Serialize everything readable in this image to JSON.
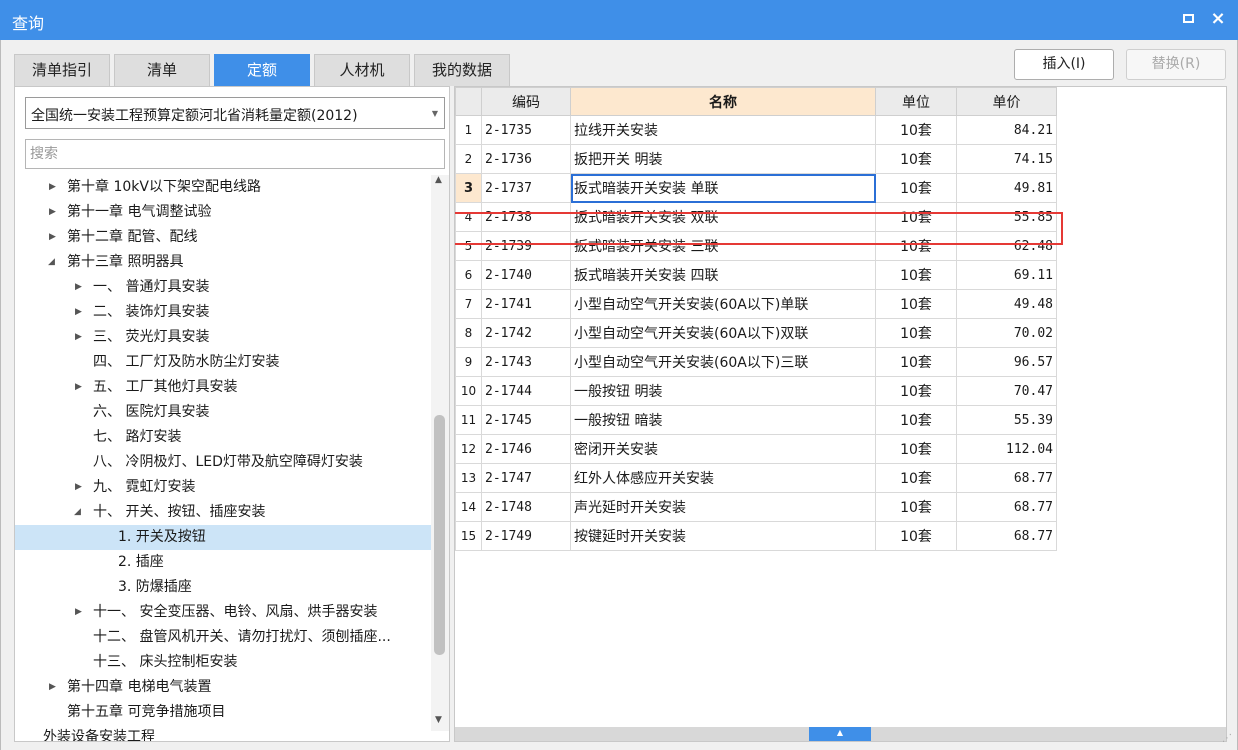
{
  "window": {
    "title": "查询",
    "restore_icon": "restore-icon",
    "close_glyph": "×"
  },
  "tabs": [
    {
      "label": "清单指引",
      "active": false
    },
    {
      "label": "清单",
      "active": false
    },
    {
      "label": "定额",
      "active": true
    },
    {
      "label": "人材机",
      "active": false
    },
    {
      "label": "我的数据",
      "active": false
    }
  ],
  "buttons": {
    "insert": "插入(I)",
    "replace": "替换(R)"
  },
  "left": {
    "combo_value": "全国统一安装工程预算定额河北省消耗量定额(2012)",
    "search_placeholder": "搜索",
    "tree": [
      {
        "label": "第十章 10kV以下架空配电线路",
        "toggle": "▶"
      },
      {
        "label": "第十一章 电气调整试验",
        "toggle": "▶"
      },
      {
        "label": "第十二章 配管、配线",
        "toggle": "▶"
      },
      {
        "label": "第十三章 照明器具",
        "toggle": "◢"
      },
      {
        "label": "一、 普通灯具安装",
        "toggle": "▶"
      },
      {
        "label": "二、 装饰灯具安装",
        "toggle": "▶"
      },
      {
        "label": "三、 荧光灯具安装",
        "toggle": "▶"
      },
      {
        "label": "四、 工厂灯及防水防尘灯安装",
        "toggle": ""
      },
      {
        "label": "五、 工厂其他灯具安装",
        "toggle": "▶"
      },
      {
        "label": "六、 医院灯具安装",
        "toggle": ""
      },
      {
        "label": "七、 路灯安装",
        "toggle": ""
      },
      {
        "label": "八、 冷阴极灯、LED灯带及航空障碍灯安装",
        "toggle": ""
      },
      {
        "label": "九、 霓虹灯安装",
        "toggle": "▶"
      },
      {
        "label": "十、 开关、按钮、插座安装",
        "toggle": "◢"
      },
      {
        "label": "1. 开关及按钮",
        "toggle": ""
      },
      {
        "label": "2. 插座",
        "toggle": ""
      },
      {
        "label": "3. 防爆插座",
        "toggle": ""
      },
      {
        "label": "十一、 安全变压器、电铃、风扇、烘手器安装",
        "toggle": "▶"
      },
      {
        "label": "十二、 盘管风机开关、请勿打扰灯、须刨插座...",
        "toggle": ""
      },
      {
        "label": "十三、 床头控制柜安装",
        "toggle": ""
      },
      {
        "label": "第十四章 电梯电气装置",
        "toggle": "▶"
      },
      {
        "label": "第十五章 可竞争措施项目",
        "toggle": ""
      },
      {
        "label": "外装设备安装工程",
        "toggle": ""
      }
    ],
    "scroll_up": "▲",
    "scroll_down": "▼"
  },
  "grid": {
    "headers": {
      "code": "编码",
      "name": "名称",
      "unit": "单位",
      "price": "单价"
    },
    "rows": [
      {
        "num": "1",
        "code": "2-1735",
        "name": "拉线开关安装",
        "unit": "10套",
        "price": "84.21"
      },
      {
        "num": "2",
        "code": "2-1736",
        "name": "扳把开关 明装",
        "unit": "10套",
        "price": "74.15"
      },
      {
        "num": "3",
        "code": "2-1737",
        "name": "扳式暗装开关安装 单联",
        "unit": "10套",
        "price": "49.81"
      },
      {
        "num": "4",
        "code": "2-1738",
        "name": "扳式暗装开关安装 双联",
        "unit": "10套",
        "price": "55.85"
      },
      {
        "num": "5",
        "code": "2-1739",
        "name": "扳式暗装开关安装 三联",
        "unit": "10套",
        "price": "62.48"
      },
      {
        "num": "6",
        "code": "2-1740",
        "name": "扳式暗装开关安装 四联",
        "unit": "10套",
        "price": "69.11"
      },
      {
        "num": "7",
        "code": "2-1741",
        "name": "小型自动空气开关安装(60A以下)单联",
        "unit": "10套",
        "price": "49.48"
      },
      {
        "num": "8",
        "code": "2-1742",
        "name": "小型自动空气开关安装(60A以下)双联",
        "unit": "10套",
        "price": "70.02"
      },
      {
        "num": "9",
        "code": "2-1743",
        "name": "小型自动空气开关安装(60A以下)三联",
        "unit": "10套",
        "price": "96.57"
      },
      {
        "num": "10",
        "code": "2-1744",
        "name": "一般按钮 明装",
        "unit": "10套",
        "price": "70.47"
      },
      {
        "num": "11",
        "code": "2-1745",
        "name": "一般按钮 暗装",
        "unit": "10套",
        "price": "55.39"
      },
      {
        "num": "12",
        "code": "2-1746",
        "name": "密闭开关安装",
        "unit": "10套",
        "price": "112.04"
      },
      {
        "num": "13",
        "code": "2-1747",
        "name": "红外人体感应开关安装",
        "unit": "10套",
        "price": "68.77"
      },
      {
        "num": "14",
        "code": "2-1748",
        "name": "声光延时开关安装",
        "unit": "10套",
        "price": "68.77"
      },
      {
        "num": "15",
        "code": "2-1749",
        "name": "按键延时开关安装",
        "unit": "10套",
        "price": "68.77"
      }
    ],
    "collapse_glyph": "▲"
  },
  "colors": {
    "accent": "#3f8fe8",
    "highlight_border": "#e53935",
    "selected_tree": "#cce4f7",
    "header_highlight": "#fde8cf"
  }
}
